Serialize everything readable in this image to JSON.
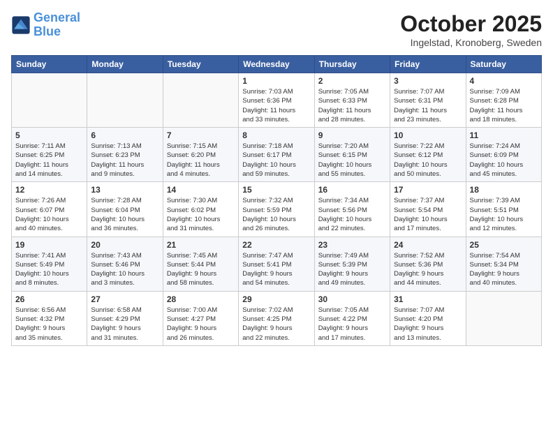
{
  "header": {
    "logo_line1": "General",
    "logo_line2": "Blue",
    "month": "October 2025",
    "location": "Ingelstad, Kronoberg, Sweden"
  },
  "days_of_week": [
    "Sunday",
    "Monday",
    "Tuesday",
    "Wednesday",
    "Thursday",
    "Friday",
    "Saturday"
  ],
  "weeks": [
    [
      {
        "day": "",
        "content": ""
      },
      {
        "day": "",
        "content": ""
      },
      {
        "day": "",
        "content": ""
      },
      {
        "day": "1",
        "content": "Sunrise: 7:03 AM\nSunset: 6:36 PM\nDaylight: 11 hours\nand 33 minutes."
      },
      {
        "day": "2",
        "content": "Sunrise: 7:05 AM\nSunset: 6:33 PM\nDaylight: 11 hours\nand 28 minutes."
      },
      {
        "day": "3",
        "content": "Sunrise: 7:07 AM\nSunset: 6:31 PM\nDaylight: 11 hours\nand 23 minutes."
      },
      {
        "day": "4",
        "content": "Sunrise: 7:09 AM\nSunset: 6:28 PM\nDaylight: 11 hours\nand 18 minutes."
      }
    ],
    [
      {
        "day": "5",
        "content": "Sunrise: 7:11 AM\nSunset: 6:25 PM\nDaylight: 11 hours\nand 14 minutes."
      },
      {
        "day": "6",
        "content": "Sunrise: 7:13 AM\nSunset: 6:23 PM\nDaylight: 11 hours\nand 9 minutes."
      },
      {
        "day": "7",
        "content": "Sunrise: 7:15 AM\nSunset: 6:20 PM\nDaylight: 11 hours\nand 4 minutes."
      },
      {
        "day": "8",
        "content": "Sunrise: 7:18 AM\nSunset: 6:17 PM\nDaylight: 10 hours\nand 59 minutes."
      },
      {
        "day": "9",
        "content": "Sunrise: 7:20 AM\nSunset: 6:15 PM\nDaylight: 10 hours\nand 55 minutes."
      },
      {
        "day": "10",
        "content": "Sunrise: 7:22 AM\nSunset: 6:12 PM\nDaylight: 10 hours\nand 50 minutes."
      },
      {
        "day": "11",
        "content": "Sunrise: 7:24 AM\nSunset: 6:09 PM\nDaylight: 10 hours\nand 45 minutes."
      }
    ],
    [
      {
        "day": "12",
        "content": "Sunrise: 7:26 AM\nSunset: 6:07 PM\nDaylight: 10 hours\nand 40 minutes."
      },
      {
        "day": "13",
        "content": "Sunrise: 7:28 AM\nSunset: 6:04 PM\nDaylight: 10 hours\nand 36 minutes."
      },
      {
        "day": "14",
        "content": "Sunrise: 7:30 AM\nSunset: 6:02 PM\nDaylight: 10 hours\nand 31 minutes."
      },
      {
        "day": "15",
        "content": "Sunrise: 7:32 AM\nSunset: 5:59 PM\nDaylight: 10 hours\nand 26 minutes."
      },
      {
        "day": "16",
        "content": "Sunrise: 7:34 AM\nSunset: 5:56 PM\nDaylight: 10 hours\nand 22 minutes."
      },
      {
        "day": "17",
        "content": "Sunrise: 7:37 AM\nSunset: 5:54 PM\nDaylight: 10 hours\nand 17 minutes."
      },
      {
        "day": "18",
        "content": "Sunrise: 7:39 AM\nSunset: 5:51 PM\nDaylight: 10 hours\nand 12 minutes."
      }
    ],
    [
      {
        "day": "19",
        "content": "Sunrise: 7:41 AM\nSunset: 5:49 PM\nDaylight: 10 hours\nand 8 minutes."
      },
      {
        "day": "20",
        "content": "Sunrise: 7:43 AM\nSunset: 5:46 PM\nDaylight: 10 hours\nand 3 minutes."
      },
      {
        "day": "21",
        "content": "Sunrise: 7:45 AM\nSunset: 5:44 PM\nDaylight: 9 hours\nand 58 minutes."
      },
      {
        "day": "22",
        "content": "Sunrise: 7:47 AM\nSunset: 5:41 PM\nDaylight: 9 hours\nand 54 minutes."
      },
      {
        "day": "23",
        "content": "Sunrise: 7:49 AM\nSunset: 5:39 PM\nDaylight: 9 hours\nand 49 minutes."
      },
      {
        "day": "24",
        "content": "Sunrise: 7:52 AM\nSunset: 5:36 PM\nDaylight: 9 hours\nand 44 minutes."
      },
      {
        "day": "25",
        "content": "Sunrise: 7:54 AM\nSunset: 5:34 PM\nDaylight: 9 hours\nand 40 minutes."
      }
    ],
    [
      {
        "day": "26",
        "content": "Sunrise: 6:56 AM\nSunset: 4:32 PM\nDaylight: 9 hours\nand 35 minutes."
      },
      {
        "day": "27",
        "content": "Sunrise: 6:58 AM\nSunset: 4:29 PM\nDaylight: 9 hours\nand 31 minutes."
      },
      {
        "day": "28",
        "content": "Sunrise: 7:00 AM\nSunset: 4:27 PM\nDaylight: 9 hours\nand 26 minutes."
      },
      {
        "day": "29",
        "content": "Sunrise: 7:02 AM\nSunset: 4:25 PM\nDaylight: 9 hours\nand 22 minutes."
      },
      {
        "day": "30",
        "content": "Sunrise: 7:05 AM\nSunset: 4:22 PM\nDaylight: 9 hours\nand 17 minutes."
      },
      {
        "day": "31",
        "content": "Sunrise: 7:07 AM\nSunset: 4:20 PM\nDaylight: 9 hours\nand 13 minutes."
      },
      {
        "day": "",
        "content": ""
      }
    ]
  ]
}
